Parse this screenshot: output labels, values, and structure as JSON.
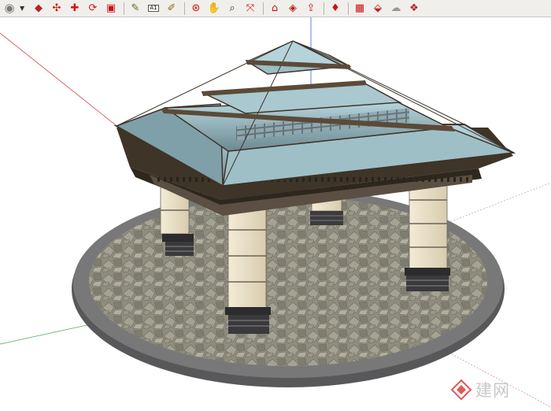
{
  "toolbar": {
    "tools": [
      {
        "name": "select-arrow-icon",
        "glyph": "◉"
      },
      {
        "name": "dropdown-arrow-icon",
        "glyph": "▾"
      },
      {
        "name": "push-pull-icon",
        "glyph": "◆"
      },
      {
        "name": "follow-me-icon",
        "glyph": "✣"
      },
      {
        "name": "move-icon",
        "glyph": "✚"
      },
      {
        "name": "rotate-icon",
        "glyph": "⟳"
      },
      {
        "name": "scale-icon",
        "glyph": "▣"
      },
      {
        "name": "tape-measure-icon",
        "glyph": "✎"
      },
      {
        "name": "text-label-icon",
        "glyph": "A1"
      },
      {
        "name": "paint-bucket-icon",
        "glyph": "✐"
      },
      {
        "name": "orbit-icon",
        "glyph": "⊛"
      },
      {
        "name": "pan-hand-icon",
        "glyph": "✋"
      },
      {
        "name": "zoom-icon",
        "glyph": "⌕"
      },
      {
        "name": "zoom-extents-icon",
        "glyph": "⤧"
      },
      {
        "name": "warehouse-icon",
        "glyph": "⌂"
      },
      {
        "name": "get-models-icon",
        "glyph": "◈"
      },
      {
        "name": "share-model-icon",
        "glyph": "⇪"
      },
      {
        "name": "ruby-icon",
        "glyph": "♦"
      },
      {
        "name": "extension-warehouse-icon",
        "glyph": "▦"
      },
      {
        "name": "component-icon",
        "glyph": "⬙"
      },
      {
        "name": "style-icon",
        "glyph": "☁"
      },
      {
        "name": "layer-icon",
        "glyph": "❖"
      }
    ]
  },
  "watermark": {
    "text": "建网"
  }
}
